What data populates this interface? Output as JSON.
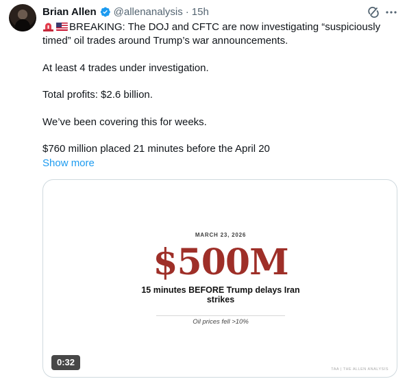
{
  "author": {
    "name": "Brian Allen",
    "handle": "@allenanalysis",
    "separator": "·",
    "time": "15h"
  },
  "icons": {
    "verified": "verified-badge-icon",
    "grok": "grok-icon",
    "more": "more-options-icon",
    "siren": "siren-emoji-icon",
    "flag": "us-flag-emoji-icon"
  },
  "colors": {
    "link": "#1d9bf0",
    "amount": "#9e2f28",
    "verified": "#1d9bf0"
  },
  "tweet": {
    "line1": "BREAKING: The DOJ and CFTC are now investigating “suspiciously timed” oil trades around Trump’s war announcements.",
    "line2": "At least 4 trades under investigation.",
    "line3": "Total profits: $2.6 billion.",
    "line4": "We’ve been covering this for weeks.",
    "line5": "$760 million placed 21 minutes before the April 20",
    "show_more": "Show more"
  },
  "media": {
    "date": "MARCH 23, 2026",
    "amount": "$500M",
    "headline": "15 minutes BEFORE Trump delays Iran strikes",
    "note": "Oil prices fell >10%",
    "duration": "0:32",
    "watermark": "TAA | THE ALLEN ANALYSIS"
  }
}
